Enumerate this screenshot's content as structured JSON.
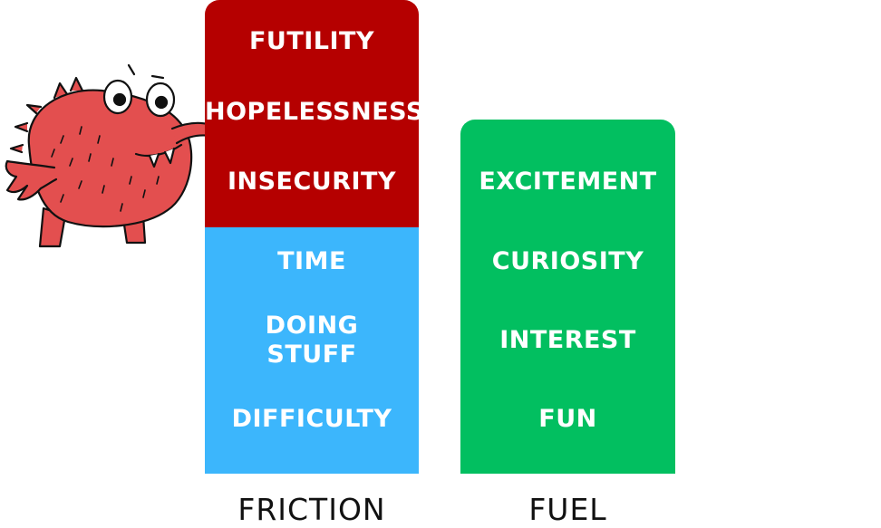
{
  "colors": {
    "friction_top": "#b50000",
    "friction_bottom": "#3cb6fc",
    "fuel": "#02bf60",
    "monster": "#e34f4f",
    "text": "#ffffff",
    "label": "#111111"
  },
  "friction": {
    "label": "FRICTION",
    "red_items": [
      "FUTILITY",
      "HOPELESSNESS",
      "INSECURITY"
    ],
    "blue_items": [
      "TIME",
      "DOING\nSTUFF",
      "DIFFICULTY"
    ]
  },
  "fuel": {
    "label": "FUEL",
    "items": [
      "EXCITEMENT",
      "CURIOSITY",
      "INTEREST",
      "FUN"
    ]
  },
  "illustration": {
    "icon": "red-fuzzy-monster-icon"
  }
}
